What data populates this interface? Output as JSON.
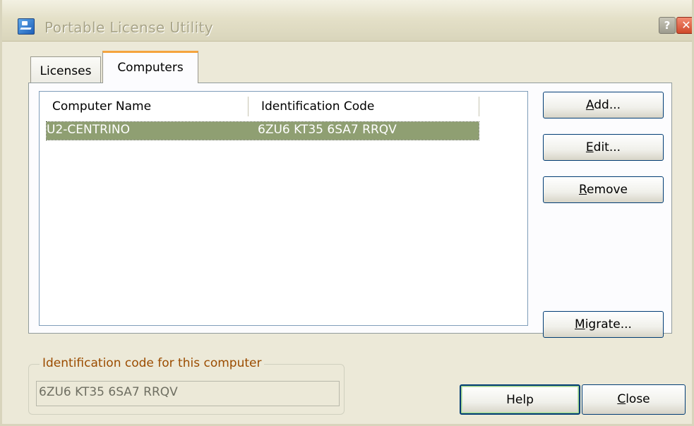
{
  "window": {
    "title": "Portable License Utility",
    "help_glyph": "?",
    "close_glyph": "✕",
    "icon": "app-icon"
  },
  "tabs": [
    {
      "label": "Licenses",
      "active": false
    },
    {
      "label": "Computers",
      "active": true
    }
  ],
  "table": {
    "columns": [
      "Computer Name",
      "Identification Code"
    ],
    "rows": [
      {
        "computer_name": "U2-CENTRINO",
        "identification_code": "6ZU6 KT35 6SA7 RRQV",
        "selected": true
      }
    ]
  },
  "buttons": {
    "add": {
      "pre": "",
      "key": "A",
      "post": "dd..."
    },
    "edit": {
      "pre": "",
      "key": "E",
      "post": "dit..."
    },
    "remove": {
      "pre": "",
      "key": "R",
      "post": "emove"
    },
    "migrate": {
      "pre": "",
      "key": "M",
      "post": "igrate..."
    },
    "help": "Help",
    "close": {
      "pre": "",
      "key": "C",
      "post": "lose"
    }
  },
  "id_group": {
    "label": "Identification code for this computer",
    "value": "6ZU6 KT35 6SA7 RRQV"
  },
  "colors": {
    "window_bg": "#ece9d8",
    "selected_row": "#8f9f72",
    "active_tab_accent": "#f5a43e",
    "group_label": "#9b4c00"
  }
}
